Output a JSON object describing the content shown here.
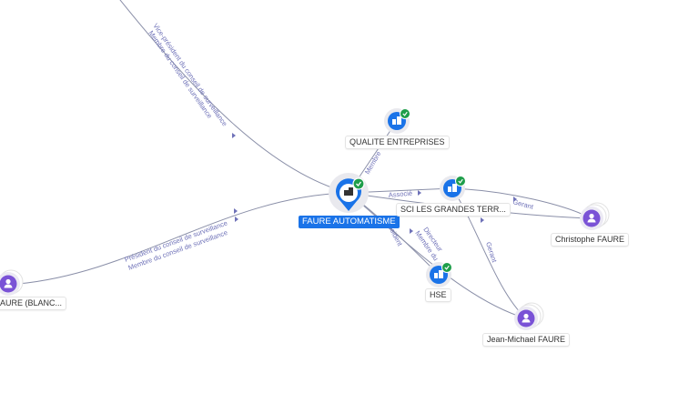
{
  "colors": {
    "accent": "#1a73e8",
    "company": "#1a73e8",
    "person": "#7a52d6",
    "verified": "#1e9e4a",
    "edge": "#8a8fa8",
    "edge_label": "#6f72b8"
  },
  "nodes": {
    "main": {
      "label": "FAURE AUTOMATISME",
      "icon": "company-icon"
    },
    "qualite": {
      "label": "QUALITE ENTREPRISES",
      "icon": "company-icon"
    },
    "sci": {
      "label": "SCI LES GRANDES TERR...",
      "icon": "company-icon"
    },
    "hse": {
      "label": "HSE",
      "icon": "company-icon"
    },
    "christophe": {
      "label": "Christophe FAURE",
      "icon": "person-icon"
    },
    "jeanmichel": {
      "label": "Jean-Michael FAURE",
      "icon": "person-icon"
    },
    "blanc": {
      "label": "AURE (BLANC...",
      "icon": "person-icon"
    }
  },
  "edges": {
    "top_line1": "Vice-président du conseil de surveillance",
    "top_line2": "Membre du conseil de surveillance",
    "left_line1": "Président du conseil de surveillance",
    "left_line2": "Membre du conseil de surveillance",
    "qualite": "Membre",
    "sci": "Associé",
    "christophe_sci": "Gerant",
    "jm_sci": "Gerant",
    "hse": "Président",
    "jm_line1": "Directeur",
    "jm_line2": "Membre du"
  }
}
